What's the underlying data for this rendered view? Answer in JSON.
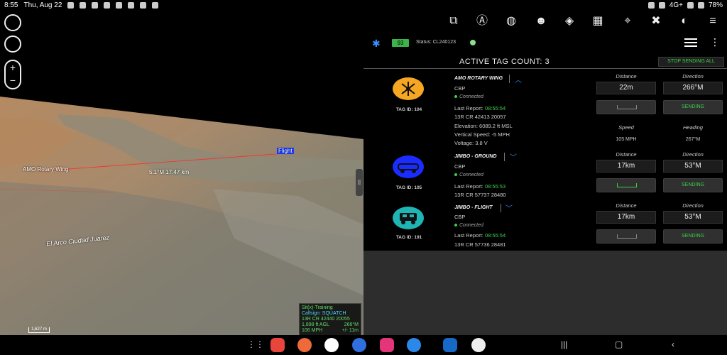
{
  "status_bar": {
    "time": "8:55",
    "date": "Thu, Aug 22",
    "network": "4G+",
    "battery": "78%"
  },
  "map": {
    "labels": {
      "track_marker": "AMO Rotary Wing",
      "measure": "5.1°M 17.47 km",
      "place": "El Arco Ciudad Juarez",
      "target_marker": "Flight"
    },
    "scale": "1,627 m",
    "info": {
      "title": "Sit(x)-Training",
      "callsign": "Callsign: SQUATCH",
      "coord": "13R CR 42440 20055",
      "agl": "1,898 ft AGL",
      "heading": "266°M",
      "speed": "106 MPH",
      "accuracy": "+/- 11m"
    }
  },
  "panel": {
    "battery_level": "93",
    "status": "Status: CL240123",
    "count_label": "ACTIVE TAG COUNT:  3",
    "stop_button": "STOP SENDING ALL",
    "headers": {
      "distance": "Distance",
      "direction": "Direction",
      "speed": "Speed",
      "heading": "Heading"
    },
    "tags": [
      {
        "name": "AMO ROTARY WING",
        "agency": "CBP",
        "connection": "Connected",
        "tag_id": "TAG ID: 104",
        "last_report_label": "Last Report:",
        "last_report_time": "08:55:54",
        "grid": "13R CR 42413 20057",
        "elevation": "Elevation: 6089.2 ft MSL",
        "vspeed": "Vertical Speed: -5 MPH",
        "voltage": "Voltage: 3.8 V",
        "distance": "22m",
        "direction": "266°M",
        "speed": "105 MPH",
        "heading": "267°M",
        "send": "SENDING",
        "color": "#f5a623"
      },
      {
        "name": "JIMBO - GROUND",
        "agency": "CBP",
        "connection": "Connected",
        "tag_id": "TAG ID: 105",
        "last_report_label": "Last Report:",
        "last_report_time": "08:55:53",
        "grid": "13R CR 57737 28480",
        "distance": "17km",
        "direction": "53°M",
        "send": "SENDING",
        "color": "#1a2cff"
      },
      {
        "name": "JIMBO - FLIGHT",
        "agency": "CBP",
        "connection": "Connected",
        "tag_id": "TAG ID: 191",
        "last_report_label": "Last Report:",
        "last_report_time": "08:55:54",
        "grid": "13R CR 57736 28481",
        "distance": "17km",
        "direction": "53°M",
        "send": "SENDING",
        "color": "#1fb5b5"
      }
    ]
  },
  "colors": {
    "accent_green": "#3bd04a",
    "accent_blue": "#3a8cff",
    "panel_bg": "#2d2d2d"
  }
}
